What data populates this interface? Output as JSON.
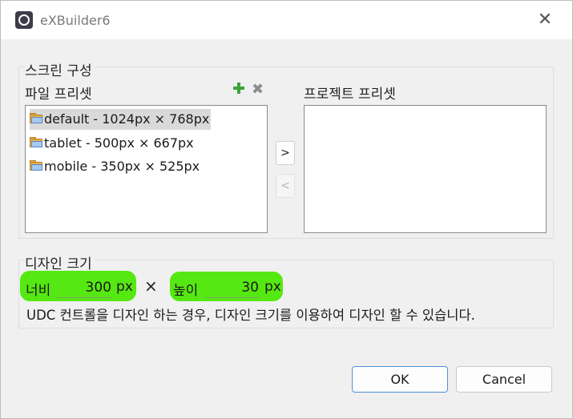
{
  "window": {
    "title": "eXBuilder6",
    "close_glyph": "✕"
  },
  "screen_config": {
    "group_label": "스크린 구성",
    "file_preset_label": "파일 프리셋",
    "project_preset_label": "프로젝트 프리셋",
    "file_presets": [
      {
        "label": "default - 1024px × 768px",
        "selected": true
      },
      {
        "label": "tablet - 500px × 667px",
        "selected": false
      },
      {
        "label": "mobile - 350px × 525px",
        "selected": false
      }
    ],
    "project_presets": [],
    "move_right_label": ">",
    "move_left_label": "<",
    "add_icon": "plus-icon",
    "remove_icon": "x-icon",
    "remove_glyph": "✖"
  },
  "design_size": {
    "group_label": "디자인 크기",
    "width_label": "너비",
    "width_value": "300",
    "width_unit": "px",
    "times_sign": "×",
    "height_label": "높이",
    "height_value": "30",
    "height_unit": "px",
    "highlight_color": "#56e812",
    "help_text": "UDC 컨트롤을 디자인 하는 경우, 디자인 크기를 이용하여 디자인 할 수 있습니다."
  },
  "footer": {
    "ok_label": "OK",
    "cancel_label": "Cancel"
  }
}
